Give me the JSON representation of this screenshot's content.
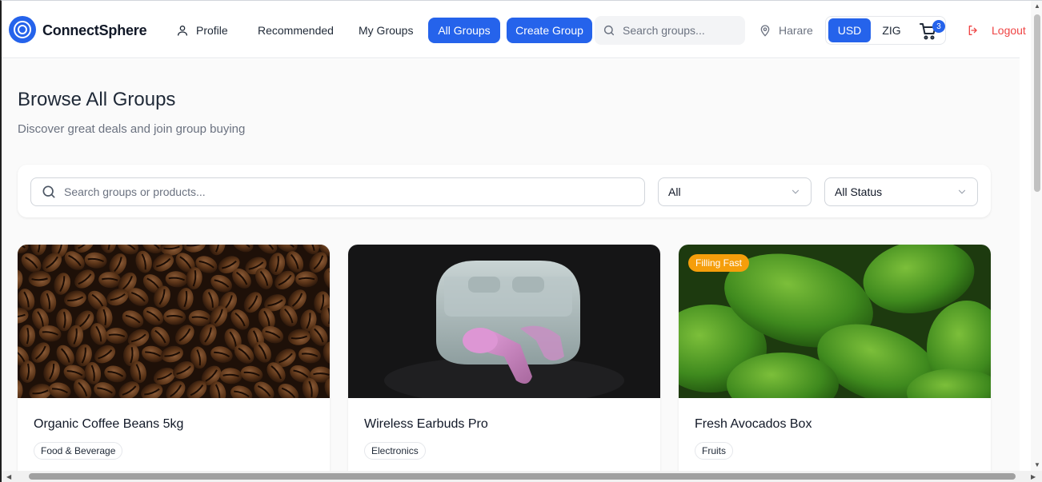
{
  "header": {
    "brand": "ConnectSphere",
    "nav": {
      "profile": "Profile",
      "recommended": "Recommended",
      "my_groups": "My Groups",
      "all_groups": "All Groups",
      "create_group": "Create Group"
    },
    "search_placeholder": "Search groups...",
    "location": "Harare",
    "currency": {
      "usd": "USD",
      "zig": "ZIG",
      "selected": "USD"
    },
    "cart_count": "3",
    "logout": "Logout"
  },
  "page": {
    "title": "Browse All Groups",
    "subtitle": "Discover great deals and join group buying"
  },
  "filters": {
    "search_placeholder": "Search groups or products...",
    "category": "All",
    "status": "All Status"
  },
  "groups": [
    {
      "title": "Organic Coffee Beans 5kg",
      "category": "Food & Beverage",
      "badge": ""
    },
    {
      "title": "Wireless Earbuds Pro",
      "category": "Electronics",
      "badge": ""
    },
    {
      "title": "Fresh Avocados Box",
      "category": "Fruits",
      "badge": "Filling Fast"
    }
  ],
  "colors": {
    "primary": "#2563eb",
    "logout": "#ef4444",
    "badge": "#f59e0b"
  }
}
